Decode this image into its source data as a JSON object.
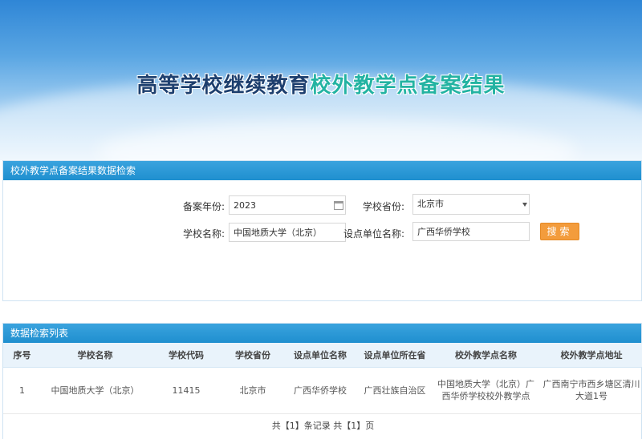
{
  "banner": {
    "title_part1": "高等学校继续教育",
    "title_part2": "校外教学点备案结果"
  },
  "search_panel": {
    "header": "校外教学点备案结果数据检索",
    "year_label": "备案年份:",
    "year_value": "2023",
    "province_label": "学校省份:",
    "province_value": "北京市",
    "school_label": "学校名称:",
    "school_value": "中国地质大学（北京）",
    "unit_label": "设点单位名称:",
    "unit_value": "广西华侨学校",
    "search_button": "搜索"
  },
  "list_panel": {
    "header": "数据检索列表",
    "columns": [
      "序号",
      "学校名称",
      "学校代码",
      "学校省份",
      "设点单位名称",
      "设点单位所在省",
      "校外教学点名称",
      "校外教学点地址"
    ],
    "rows": [
      [
        "1",
        "中国地质大学（北京）",
        "11415",
        "北京市",
        "广西华侨学校",
        "广西壮族自治区",
        "中国地质大学（北京）广西华侨学校校外教学点",
        "广西南宁市西乡塘区清川大道1号"
      ]
    ],
    "pager": "共【1】条记录 共【1】页"
  },
  "colors": {
    "header_blue": "#1f8fcf",
    "title_dark": "#1d3f6e",
    "title_teal": "#23b3a2",
    "button_orange": "#f39c3c"
  }
}
